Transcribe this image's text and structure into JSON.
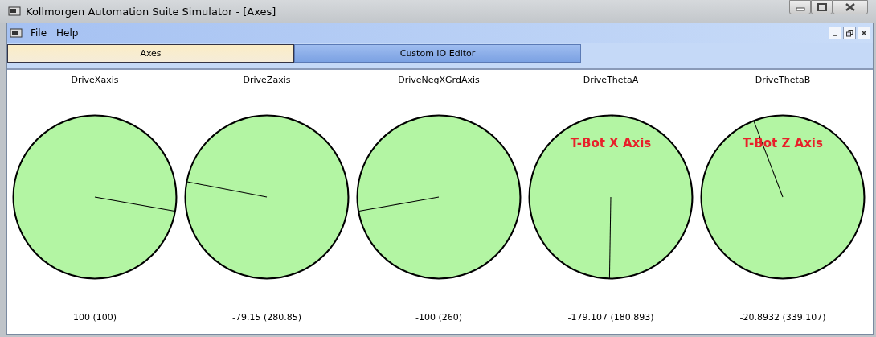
{
  "window": {
    "title": "Kollmorgen Automation Suite Simulator - [Axes]"
  },
  "menu": [
    "File",
    "Help"
  ],
  "tabs": [
    {
      "label": "Axes",
      "selected": true
    },
    {
      "label": "Custom IO Editor",
      "selected": false
    }
  ],
  "axes": [
    {
      "name": "DriveXaxis",
      "reading": "100 (100)"
    },
    {
      "name": "DriveZaxis",
      "reading": "-79.15 (280.85)"
    },
    {
      "name": "DriveNegXGrdAxis",
      "reading": "-100 (260)"
    },
    {
      "name": "DriveThetaA",
      "reading": "-179.107 (180.893)",
      "note": "T-Bot X Axis"
    },
    {
      "name": "DriveThetaB",
      "reading": "-20.8932 (339.107)",
      "note": "T-Bot Z Axis"
    }
  ]
}
